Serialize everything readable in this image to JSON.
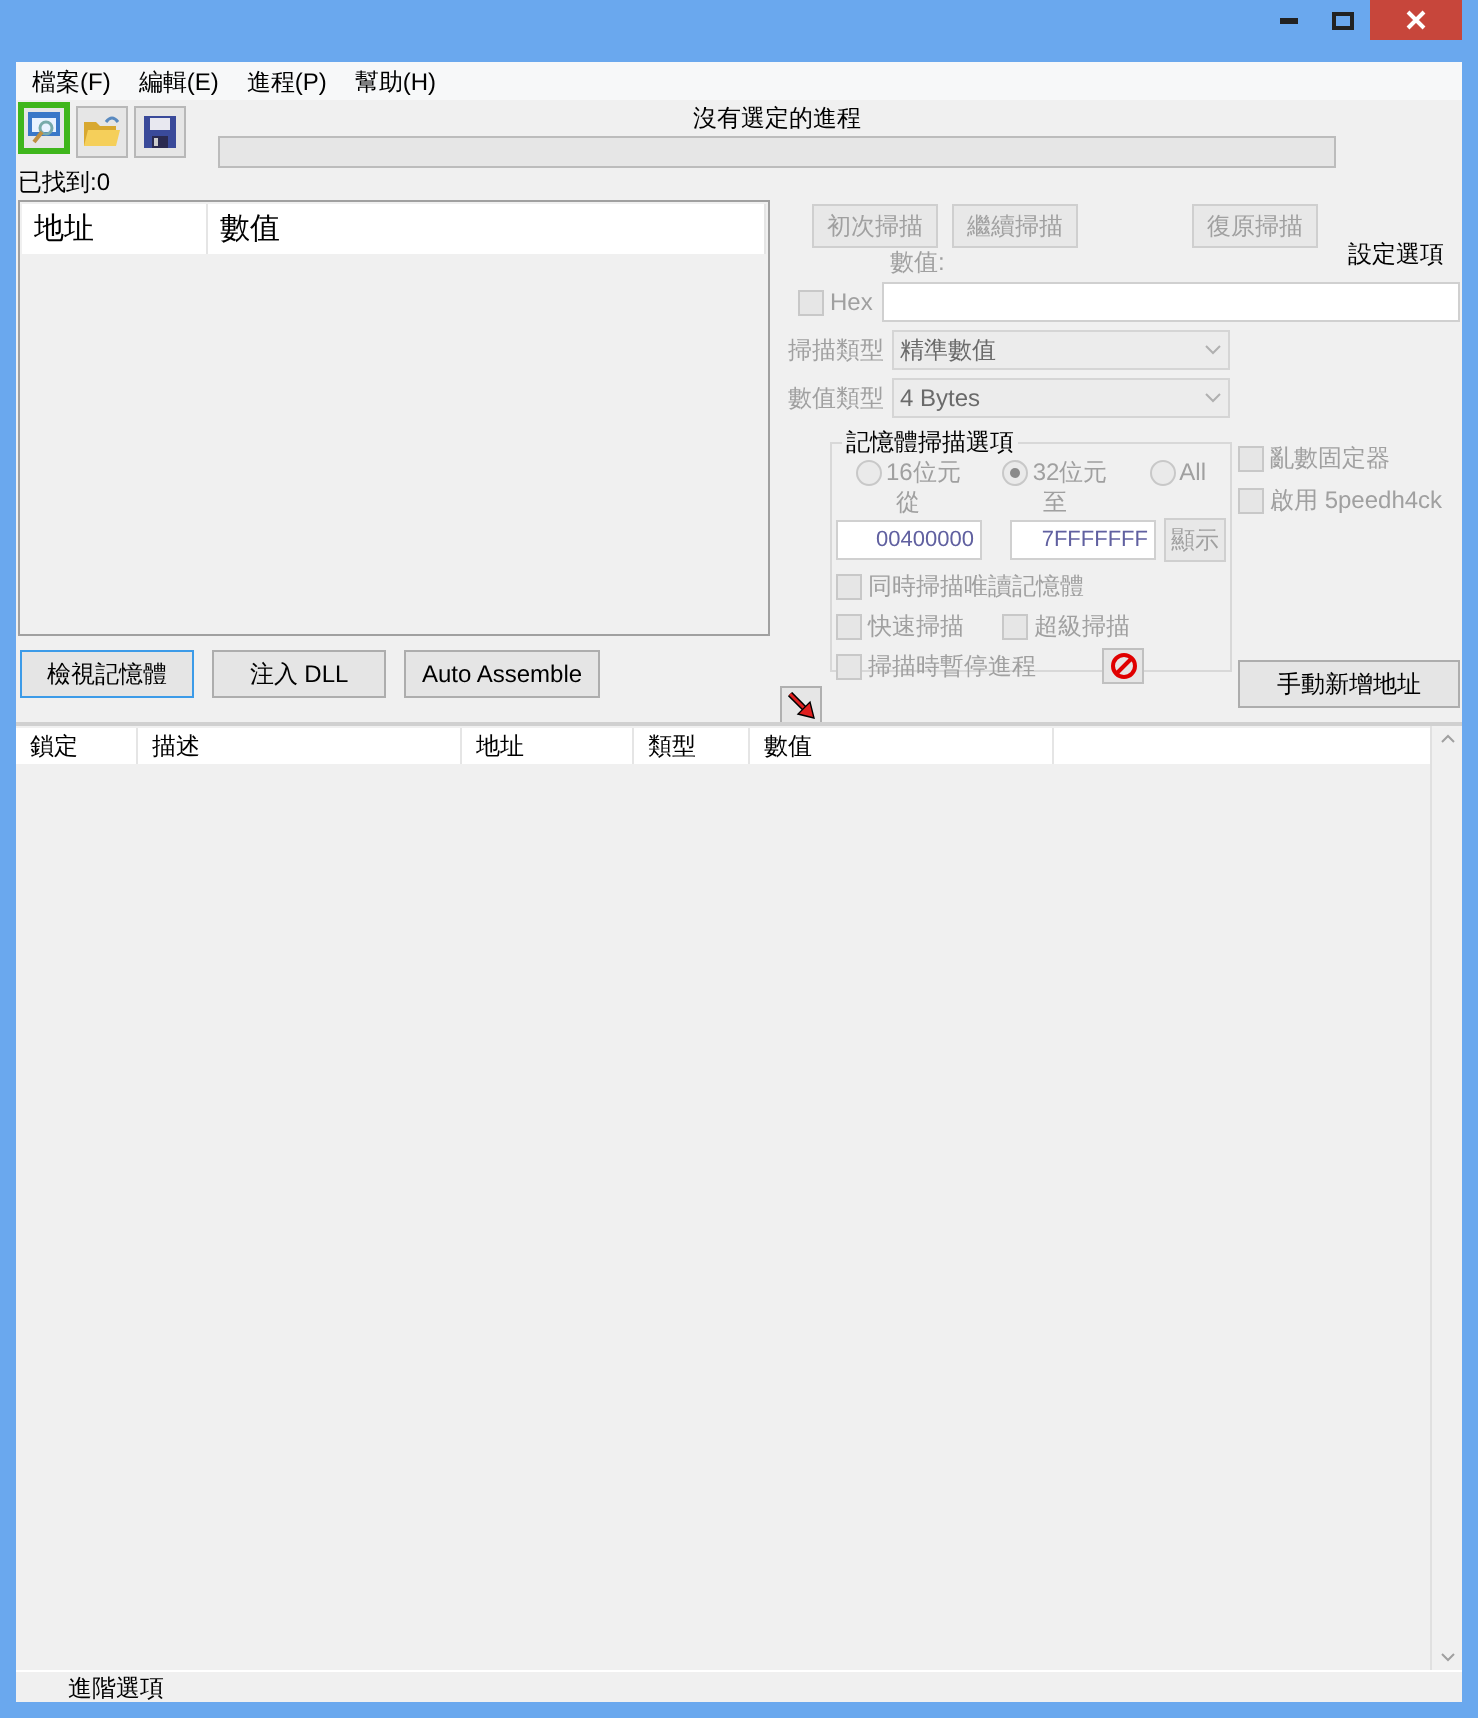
{
  "menu": [
    {
      "label": "檔案(F)"
    },
    {
      "label": "編輯(E)"
    },
    {
      "label": "進程(P)"
    },
    {
      "label": "幫助(H)"
    }
  ],
  "toolbar": [
    {
      "kind": "process",
      "highlighted": true
    },
    {
      "kind": "open",
      "highlighted": false
    },
    {
      "kind": "save",
      "highlighted": false
    }
  ],
  "process_label": "沒有選定的進程",
  "progress": {
    "level": 0
  },
  "found_label": "已找到:0",
  "results_table": {
    "columns": [
      "地址",
      "數值"
    ]
  },
  "bottom_buttons": [
    {
      "label": "檢視記憶體",
      "focused": true
    },
    {
      "label": "注入 DLL",
      "focused": false
    },
    {
      "label": "Auto Assemble",
      "focused": false
    }
  ],
  "scan_buttons": [
    {
      "label": "初次掃描",
      "disabled": true
    },
    {
      "label": "繼續掃描",
      "disabled": true
    },
    {
      "label": "復原掃描",
      "disabled": true
    }
  ],
  "settings_label": "設定選項",
  "value_label": "數值:",
  "hex": {
    "label": "Hex",
    "checked": false
  },
  "scan_type": {
    "label": "掃描類型",
    "value": "精準數值"
  },
  "value_type": {
    "label": "數值類型",
    "value": "4 Bytes"
  },
  "memory_options": {
    "title": "記憶體掃描選項",
    "radios": [
      {
        "label": "16位元",
        "selected": false
      },
      {
        "label": "32位元",
        "selected": true
      },
      {
        "label": "All",
        "selected": false
      }
    ],
    "from_label": "從",
    "to_label": "至",
    "from": "00400000",
    "to": "7FFFFFFF",
    "show_button": "顯示",
    "checkboxes": [
      {
        "label": "同時掃描唯讀記憶體",
        "checked": false
      },
      {
        "label": "快速掃描",
        "checked": false
      },
      {
        "label": "超級掃描",
        "checked": false
      },
      {
        "label": "掃描時暫停進程",
        "checked": false
      }
    ]
  },
  "side_options": [
    {
      "label": "亂數固定器",
      "checked": false
    },
    {
      "label": "啟用 5peedh4ck",
      "checked": false
    }
  ],
  "add_address_button": "手動新增地址",
  "address_table": {
    "columns": [
      "鎖定",
      "描述",
      "地址",
      "類型",
      "數值"
    ]
  },
  "status": "進階選項"
}
